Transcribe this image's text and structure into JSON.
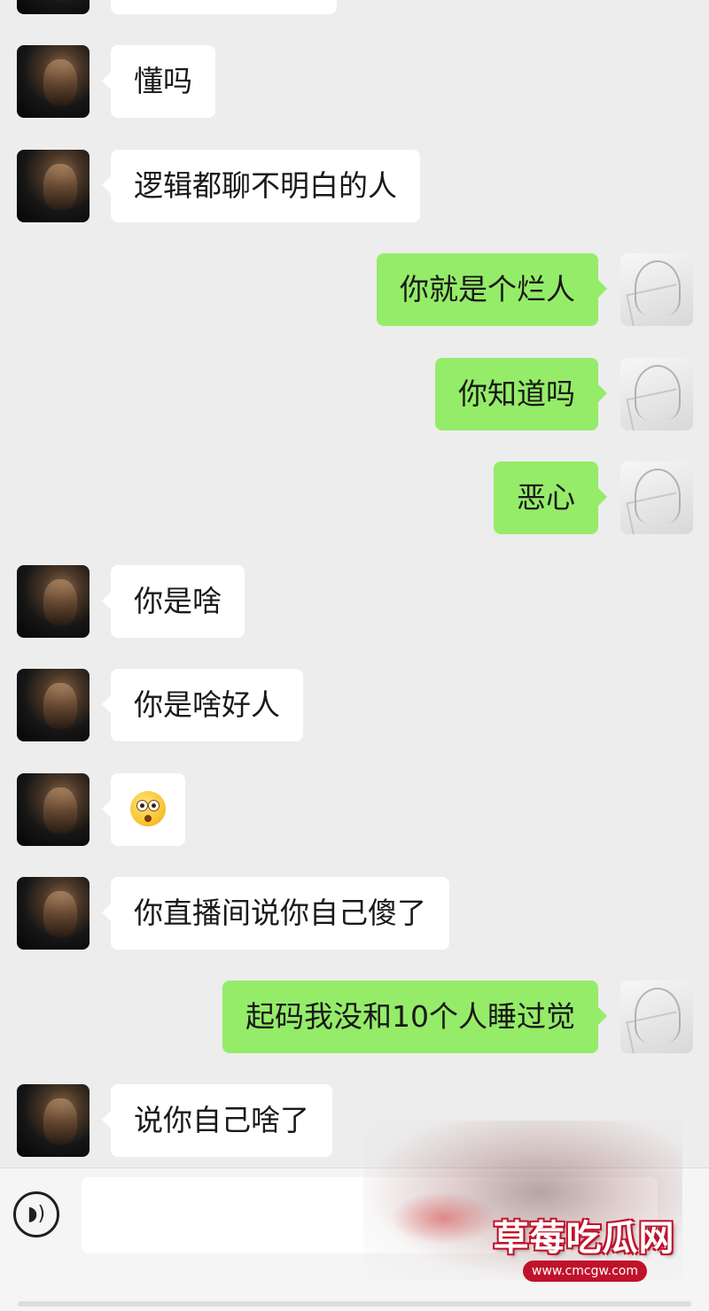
{
  "messages": [
    {
      "side": "left",
      "text": "懂吗"
    },
    {
      "side": "left",
      "text": "逻辑都聊不明白的人"
    },
    {
      "side": "right",
      "text": "你就是个烂人"
    },
    {
      "side": "right",
      "text": "你知道吗"
    },
    {
      "side": "right",
      "text": "恶心"
    },
    {
      "side": "left",
      "text": "你是啥"
    },
    {
      "side": "left",
      "text": "你是啥好人"
    },
    {
      "side": "left",
      "text": "",
      "emoji": "flushed-face-emoji"
    },
    {
      "side": "left",
      "text": "你直播间说你自己傻了"
    },
    {
      "side": "right",
      "text": "起码我没和10个人睡过觉"
    },
    {
      "side": "left",
      "text": "说你自己啥了"
    }
  ],
  "input_bar": {
    "voice_icon": "voice-mode-icon",
    "input_value": ""
  },
  "watermark": {
    "title": "草莓吃瓜网",
    "url": "www.cmcgw.com"
  },
  "colors": {
    "background": "#ededed",
    "left_bubble": "#ffffff",
    "right_bubble": "#95ec69",
    "watermark_red": "#c0132b"
  }
}
